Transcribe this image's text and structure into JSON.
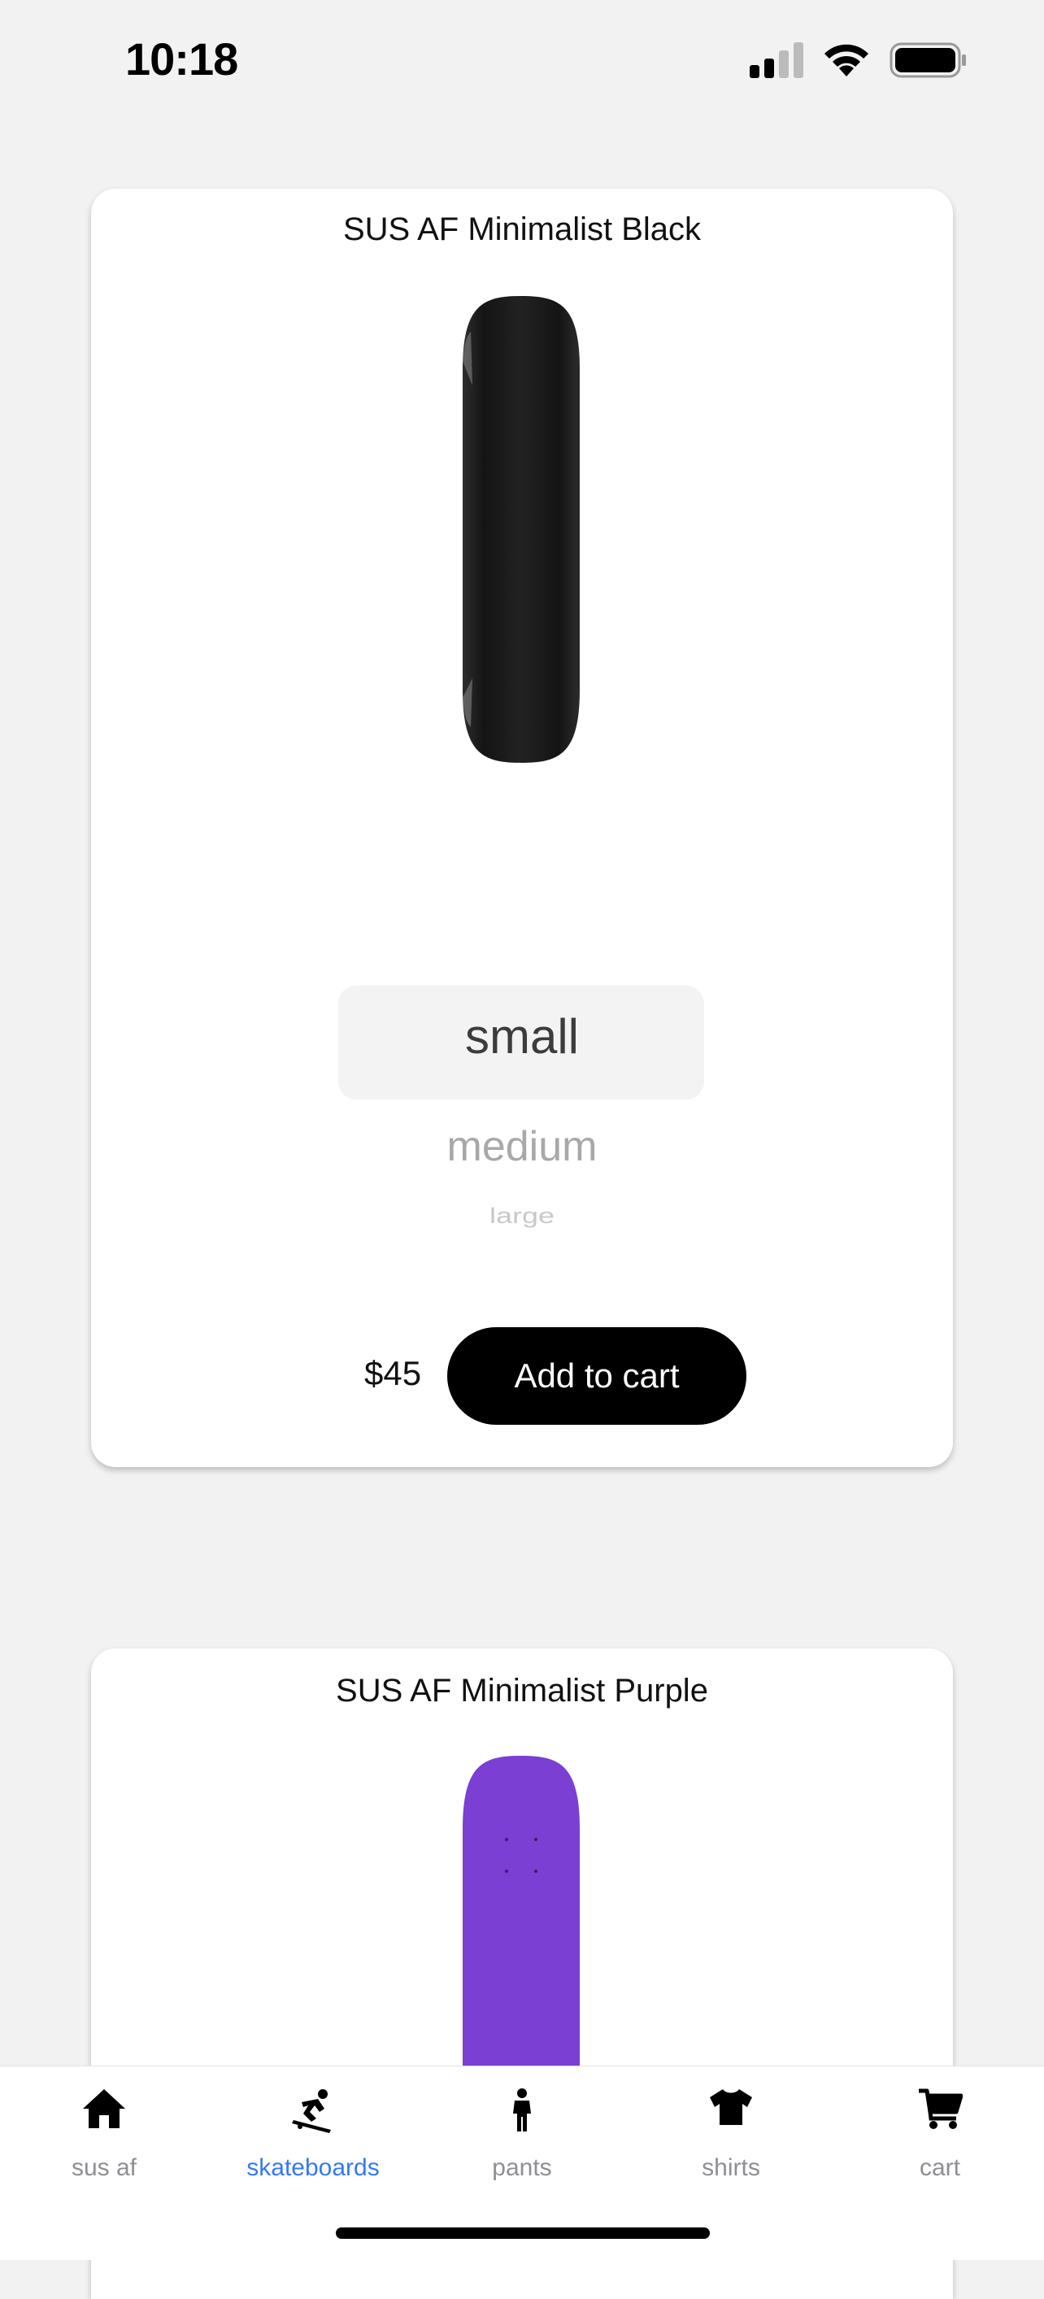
{
  "status_bar": {
    "time": "10:18"
  },
  "products": [
    {
      "title": "SUS AF Minimalist Black",
      "deck_color": "#1a1a1a",
      "sizes": [
        "small",
        "medium",
        "large"
      ],
      "selected_size": "small",
      "price": "$45",
      "add_to_cart_label": "Add to cart"
    },
    {
      "title": "SUS AF Minimalist Purple",
      "deck_color": "#7b3fd3"
    }
  ],
  "tab_bar": {
    "active_tab": "skateboards",
    "active_color": "#3478f6",
    "tabs": [
      {
        "label": "sus af",
        "icon": "home-icon"
      },
      {
        "label": "skateboards",
        "icon": "skateboarder-icon"
      },
      {
        "label": "pants",
        "icon": "person-icon"
      },
      {
        "label": "shirts",
        "icon": "shirt-icon"
      },
      {
        "label": "cart",
        "icon": "cart-icon"
      }
    ]
  }
}
